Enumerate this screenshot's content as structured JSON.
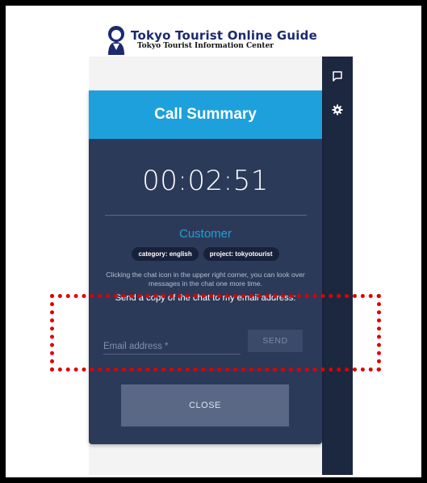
{
  "logo": {
    "title": "Tokyo Tourist Online Guide",
    "subtitle": "Tokyo Tourist Information Center"
  },
  "rail": {
    "icons": [
      "chat-icon",
      "gear-icon"
    ]
  },
  "summary": {
    "header": "Call Summary",
    "timer": "00:02:51",
    "customer_label": "Customer",
    "tags": [
      "category: english",
      "project: tokyotourist"
    ],
    "info_text": "Clicking the chat icon in the upper right corner, you can look over messages in the chat one more time.",
    "send_label": "Send a copy of the chat to my email address:",
    "email_placeholder": "Email address *",
    "send_button": "SEND",
    "close_button": "CLOSE"
  },
  "colors": {
    "header": "#1ea0dc",
    "card": "#2c3a5a",
    "rail": "#1c2740",
    "highlight": "#e10000"
  }
}
